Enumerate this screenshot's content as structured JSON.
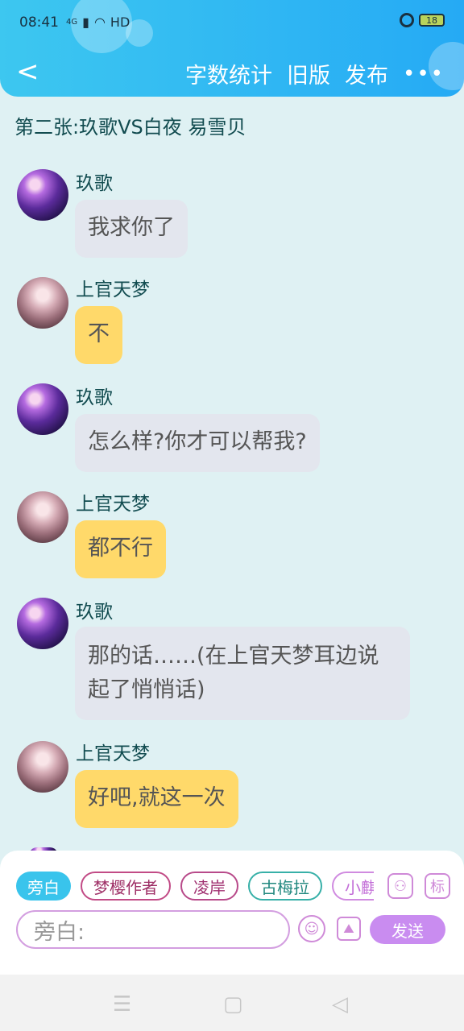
{
  "statusbar": {
    "time": "08:41",
    "network": "4G",
    "hd": "HD",
    "battery": "18"
  },
  "nav": {
    "word_count": "字数统计",
    "old_version": "旧版",
    "publish": "发布",
    "more": "•••",
    "back": "<"
  },
  "chat": {
    "title": "第二张:玖歌VS白夜   易雪贝",
    "messages": [
      {
        "sender": "玖歌",
        "text": "我求你了",
        "style": "gray"
      },
      {
        "sender": "上官天梦",
        "text": "不",
        "style": "yellow"
      },
      {
        "sender": "玖歌",
        "text": "怎么样?你才可以帮我?",
        "style": "gray"
      },
      {
        "sender": "上官天梦",
        "text": "都不行",
        "style": "yellow"
      },
      {
        "sender": "玖歌",
        "text": "那的话……(在上官天梦耳边说起了悄悄话)",
        "style": "gray"
      },
      {
        "sender": "上官天梦",
        "text": "好吧,就这一次",
        "style": "yellow"
      }
    ]
  },
  "composer": {
    "chips": [
      "旁白",
      "梦樱作者",
      "凌岸",
      "古梅拉",
      "小麒"
    ],
    "role_icon_label": "⚇",
    "tag_icon_label": "标",
    "input_placeholder": "旁白:",
    "emoji_icon": "☺",
    "image_icon": "⛰",
    "send_label": "发送"
  },
  "sysnav": {
    "menu": "☰",
    "home": "▢",
    "back": "◁"
  },
  "colors": {
    "accent": "#39c4ec",
    "yellow_bubble": "#ffd96a",
    "gray_bubble": "#e3e6ee",
    "send": "#c98cf0"
  }
}
